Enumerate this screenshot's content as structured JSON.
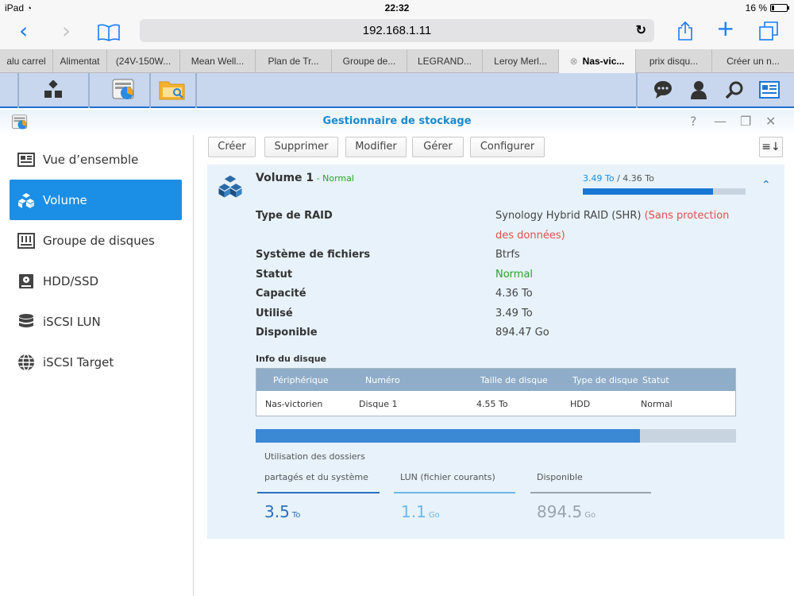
{
  "status_bar": {
    "device": "iPad",
    "time": "22:32",
    "battery": "16 %"
  },
  "browser": {
    "url": "192.168.1.11",
    "tabs": [
      {
        "label": "alu carrel"
      },
      {
        "label": "Alimentat"
      },
      {
        "label": "(24V-150W..."
      },
      {
        "label": "Mean Well..."
      },
      {
        "label": "Plan de Tr..."
      },
      {
        "label": "Groupe de..."
      },
      {
        "label": "LEGRAND..."
      },
      {
        "label": "Leroy Merl..."
      },
      {
        "label": "Nas-vic...",
        "active": true
      },
      {
        "label": "prix disqu..."
      },
      {
        "label": "Créer un n..."
      }
    ]
  },
  "window": {
    "title": "Gestionnaire de stockage"
  },
  "sidebar": {
    "items": [
      {
        "label": "Vue d’ensemble"
      },
      {
        "label": "Volume"
      },
      {
        "label": "Groupe de disques"
      },
      {
        "label": "HDD/SSD"
      },
      {
        "label": "iSCSI LUN"
      },
      {
        "label": "iSCSI Target"
      }
    ]
  },
  "toolbar": {
    "create": "Créer",
    "delete": "Supprimer",
    "edit": "Modifier",
    "manage": "Gérer",
    "configure": "Configurer"
  },
  "volume": {
    "name": "Volume 1",
    "separator": " - ",
    "status": "Normal",
    "used": "3.49 To",
    "total": "4.36 To",
    "used_fraction": 0.8,
    "details": {
      "raid_label": "Type de RAID",
      "raid_value": "Synology Hybrid RAID (SHR)",
      "raid_warning_line1": "(Sans protection",
      "raid_warning_line2": "des données)",
      "fs_label": "Système de fichiers",
      "fs_value": "Btrfs",
      "status_label": "Statut",
      "status_value": "Normal",
      "capacity_label": "Capacité",
      "capacity_value": "4.36 To",
      "used_label": "Utilisé",
      "used_value": "3.49 To",
      "available_label": "Disponible",
      "available_value": "894.47 Go"
    },
    "disk_info": {
      "title": "Info du disque",
      "columns": [
        "Périphérique",
        "Numéro",
        "Taille de disque",
        "Type de disque",
        "Statut"
      ],
      "rows": [
        [
          "Nas-victorien",
          "Disque 1",
          "4.55 To",
          "HDD",
          "Normal"
        ]
      ]
    },
    "allocation": {
      "bar_fraction": 0.8,
      "shared_label_line1": "Utilisation des dossiers",
      "shared_label_line2": "partagés et du système",
      "shared_value": "3.5",
      "shared_unit": "To",
      "lun_label": "LUN (fichier courants)",
      "lun_value": "1.1",
      "lun_unit": "Go",
      "free_label": "Disponible",
      "free_value": "894.5",
      "free_unit": "Go"
    }
  },
  "colors": {
    "accent": "#1b8fe6",
    "status_ok": "#2aa52a",
    "warning": "#e0504a",
    "panel_bg": "#e7f2fa"
  }
}
